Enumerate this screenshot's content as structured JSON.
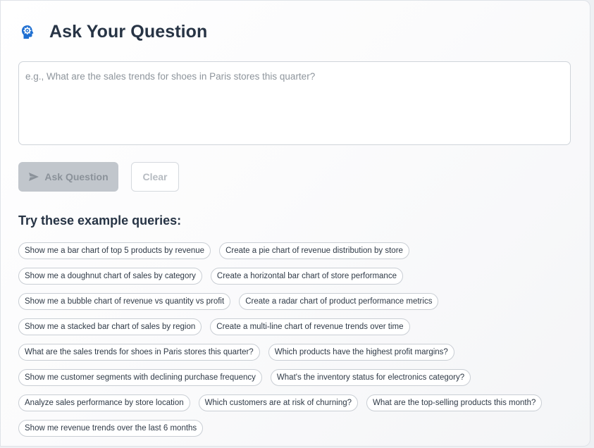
{
  "header": {
    "title": "Ask Your Question",
    "icon": "brain-icon"
  },
  "question": {
    "value": "",
    "placeholder": "e.g., What are the sales trends for shoes in Paris stores this quarter?"
  },
  "actions": {
    "ask_label": "Ask Question",
    "ask_icon": "send-icon",
    "clear_label": "Clear"
  },
  "examples": {
    "title": "Try these example queries:",
    "rows": [
      [
        "Show me a bar chart of top 5 products by revenue",
        "Create a pie chart of revenue distribution by store"
      ],
      [
        "Show me a doughnut chart of sales by category",
        "Create a horizontal bar chart of store performance"
      ],
      [
        "Show me a bubble chart of revenue vs quantity vs profit",
        "Create a radar chart of product performance metrics"
      ],
      [
        "Show me a stacked bar chart of sales by region",
        "Create a multi-line chart of revenue trends over time"
      ],
      [
        "What are the sales trends for shoes in Paris stores this quarter?",
        "Which products have the highest profit margins?"
      ],
      [
        "Show me customer segments with declining purchase frequency",
        "What's the inventory status for electronics category?"
      ],
      [
        "Analyze sales performance by store location",
        "Which customers are at risk of churning?",
        "What are the top-selling products this month?"
      ],
      [
        "Show me revenue trends over the last 6 months"
      ]
    ]
  },
  "colors": {
    "title": "#273445",
    "accent_icon": "#1f6fd1",
    "disabled_button": "#c1c6cc"
  }
}
